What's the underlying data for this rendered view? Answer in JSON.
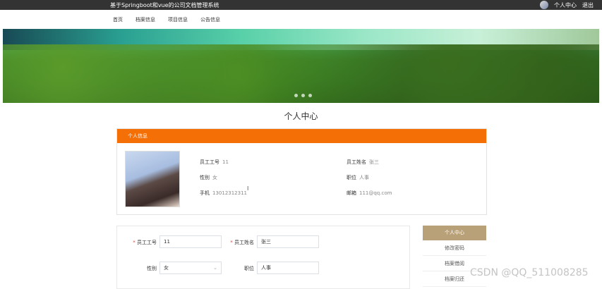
{
  "app_title": "基于Springboot和vue的公司文档管理系统",
  "topbar": {
    "profile": "个人中心",
    "logout": "退出"
  },
  "nav": [
    "首页",
    "档案信息",
    "项目信息",
    "公告信息"
  ],
  "page_title": "个人中心",
  "info": {
    "header": "个人信息",
    "emp_no_label": "员工工号",
    "emp_no": "11",
    "name_label": "员工姓名",
    "name": "张三",
    "gender_label": "性别",
    "gender": "女",
    "position_label": "职位",
    "position": "人事",
    "phone_label": "手机",
    "phone": "13012312311",
    "email_label": "邮箱",
    "email": "111@qq.com"
  },
  "form": {
    "emp_no_label": "员工工号",
    "emp_no": "11",
    "name_label": "员工姓名",
    "name": "张三",
    "gender_label": "性别",
    "gender": "女",
    "position_label": "职位",
    "position": "人事"
  },
  "side": {
    "active": "个人中心",
    "items": [
      "修改密码",
      "档案借阅",
      "档案归还"
    ]
  },
  "watermark": "CSDN @QQ_511008285"
}
